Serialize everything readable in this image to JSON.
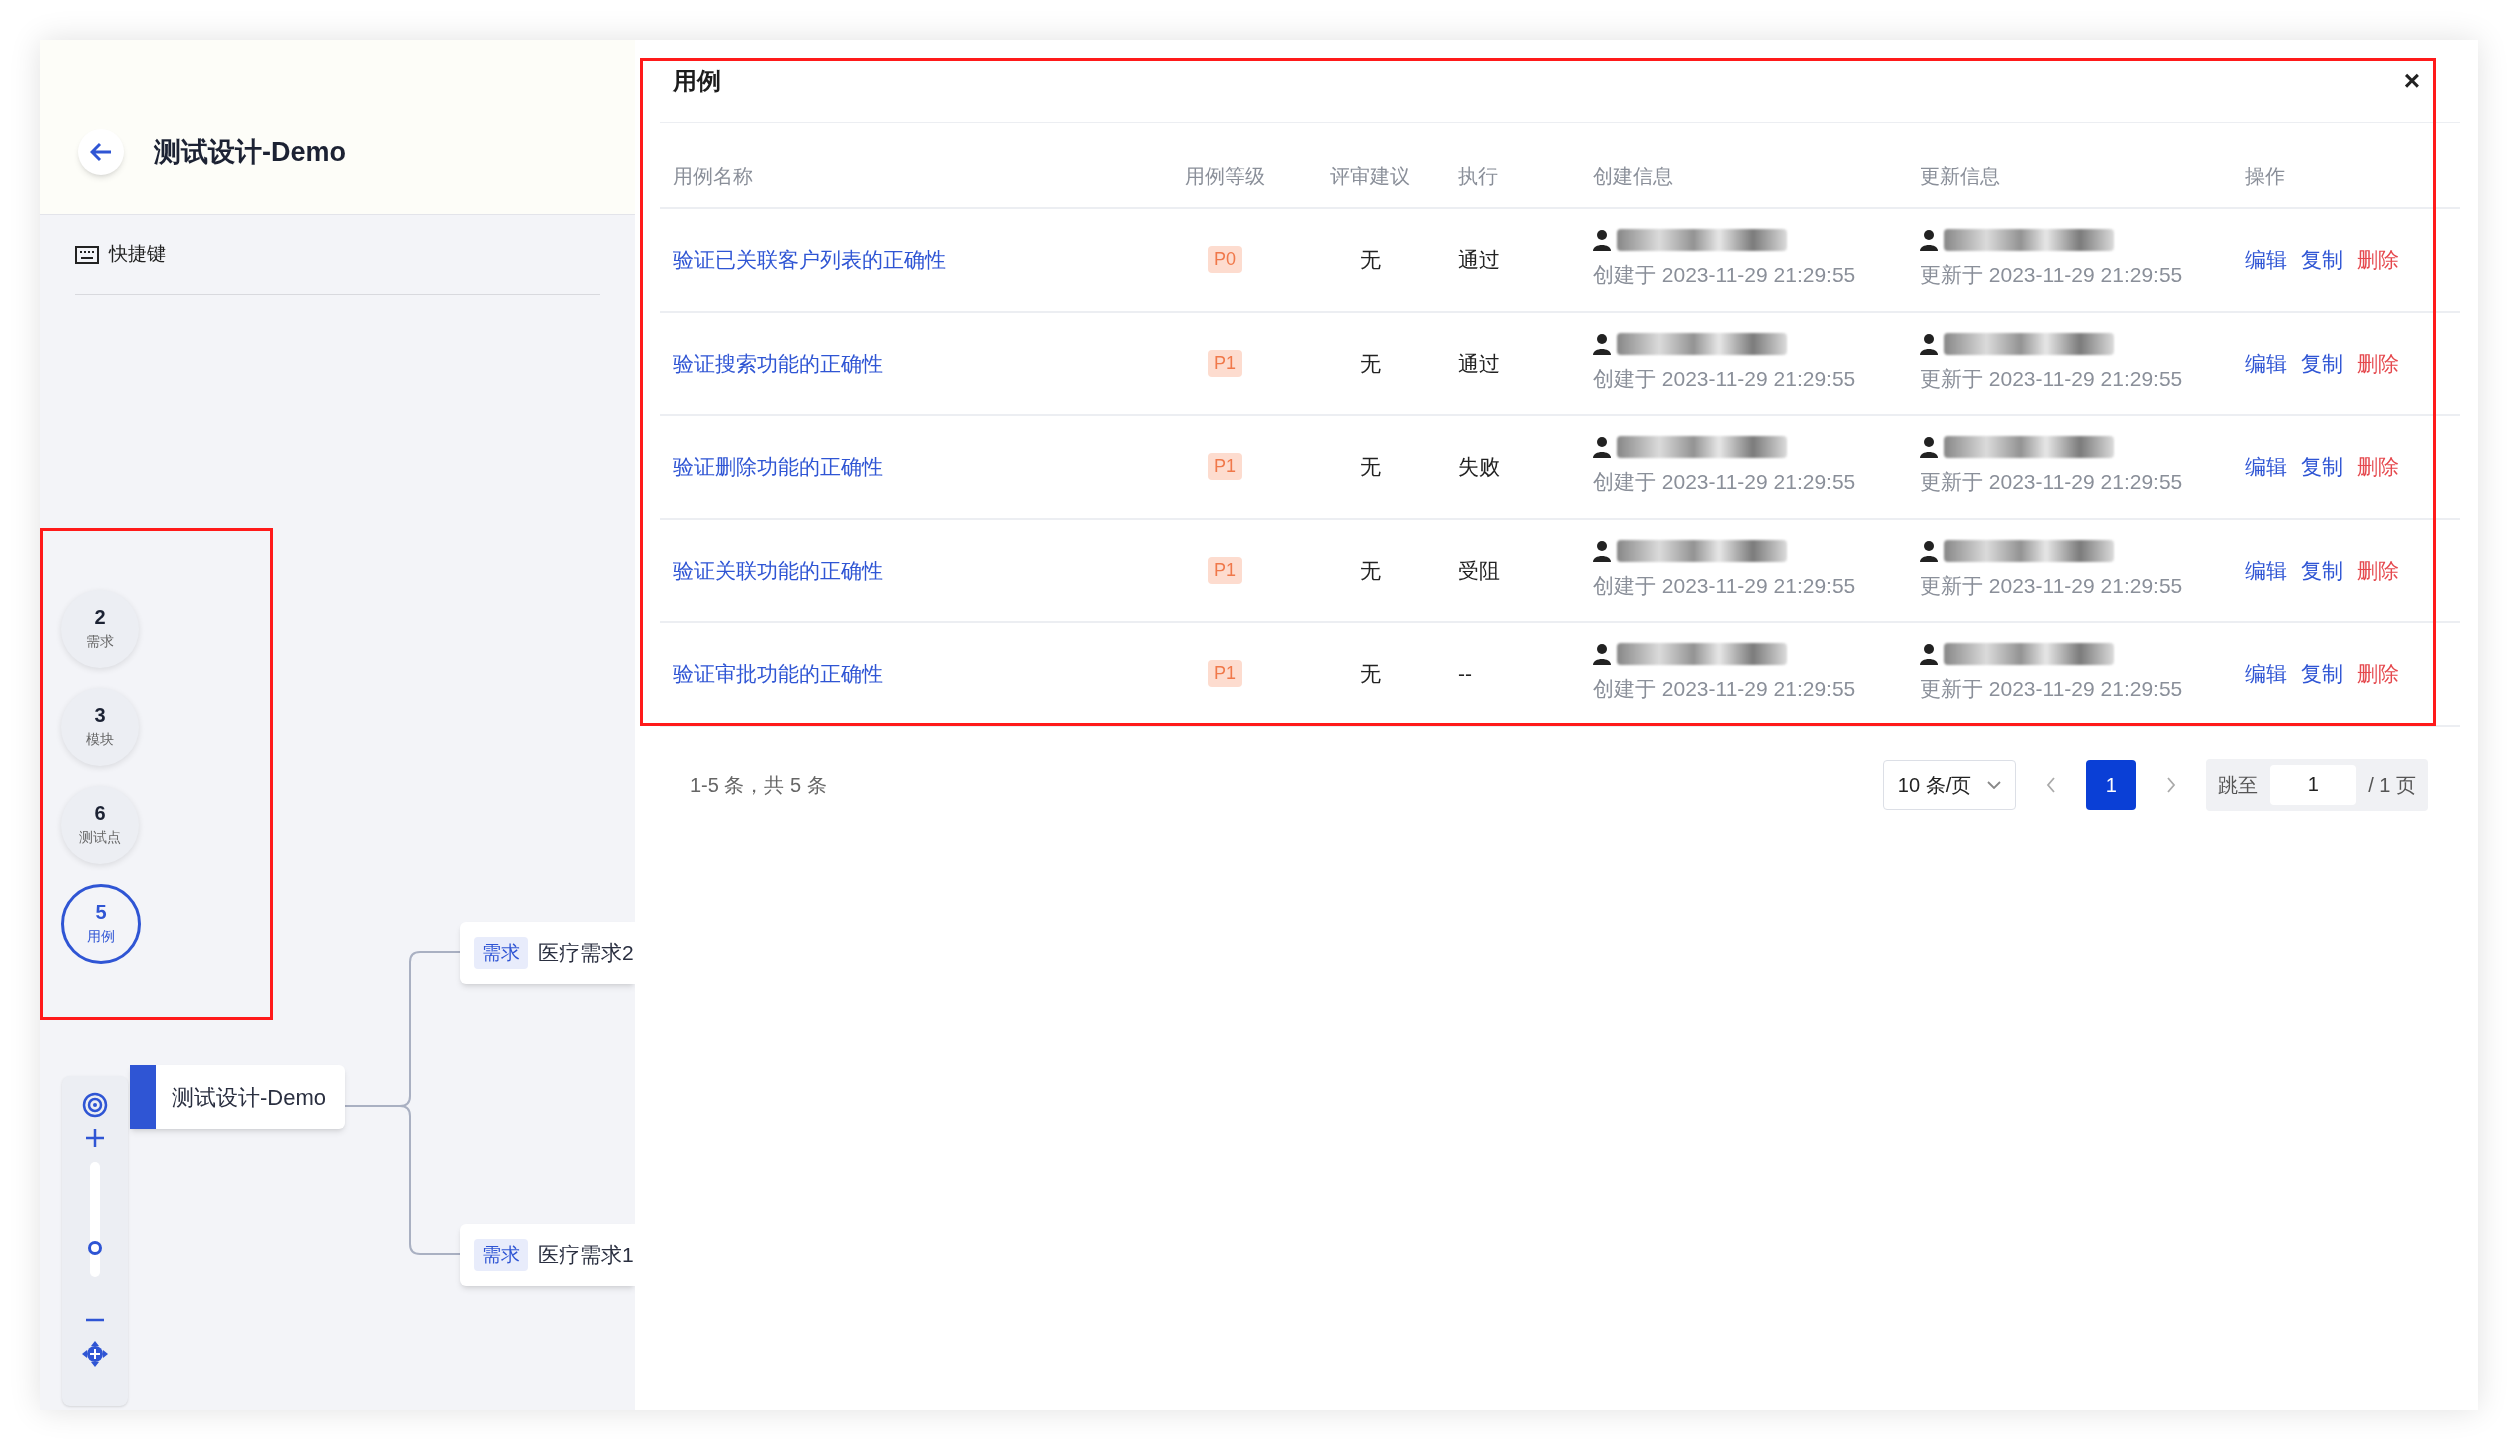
{
  "header": {
    "title": "测试设计-Demo"
  },
  "shortcut": {
    "label": "快捷键"
  },
  "stats": [
    {
      "count": "2",
      "label": "需求",
      "selected": false
    },
    {
      "count": "3",
      "label": "模块",
      "selected": false
    },
    {
      "count": "6",
      "label": "测试点",
      "selected": false
    },
    {
      "count": "5",
      "label": "用例",
      "selected": true
    }
  ],
  "mind_map": {
    "root": "测试设计-Demo",
    "children": [
      {
        "tag": "需求",
        "label": "医疗需求2"
      },
      {
        "tag": "需求",
        "label": "医疗需求1"
      }
    ]
  },
  "zoom_control": {
    "level": 0.25
  },
  "dialog": {
    "title": "用例",
    "close": "×",
    "columns": [
      "用例名称",
      "用例等级",
      "评审建议",
      "执行",
      "创建信息",
      "更新信息",
      "操作"
    ],
    "rows": [
      {
        "name": "验证已关联客户列表的正确性",
        "level_tag": "P0",
        "review": "无",
        "execution": "通过",
        "created": "创建于 2023-11-29 21:29:55",
        "updated": "更新于 2023-11-29 21:29:55",
        "actions": [
          {
            "label": "编辑",
            "kind": "normal"
          },
          {
            "label": "复制",
            "kind": "normal"
          },
          {
            "label": "删除",
            "kind": "danger"
          }
        ]
      },
      {
        "name": "验证搜索功能的正确性",
        "level_tag": "P1",
        "review": "无",
        "execution": "通过",
        "created": "创建于 2023-11-29 21:29:55",
        "updated": "更新于 2023-11-29 21:29:55",
        "actions": [
          {
            "label": "编辑",
            "kind": "normal"
          },
          {
            "label": "复制",
            "kind": "normal"
          },
          {
            "label": "删除",
            "kind": "danger"
          }
        ]
      },
      {
        "name": "验证删除功能的正确性",
        "level_tag": "P1",
        "review": "无",
        "execution": "失败",
        "created": "创建于 2023-11-29 21:29:55",
        "updated": "更新于 2023-11-29 21:29:55",
        "actions": [
          {
            "label": "编辑",
            "kind": "normal"
          },
          {
            "label": "复制",
            "kind": "normal"
          },
          {
            "label": "删除",
            "kind": "danger"
          }
        ]
      },
      {
        "name": "验证关联功能的正确性",
        "level_tag": "P1",
        "review": "无",
        "execution": "受阻",
        "created": "创建于 2023-11-29 21:29:55",
        "updated": "更新于 2023-11-29 21:29:55",
        "actions": [
          {
            "label": "编辑",
            "kind": "normal"
          },
          {
            "label": "复制",
            "kind": "normal"
          },
          {
            "label": "删除",
            "kind": "danger"
          }
        ]
      },
      {
        "name": "验证审批功能的正确性",
        "level_tag": "P1",
        "review": "无",
        "execution": "--",
        "created": "创建于 2023-11-29 21:29:55",
        "updated": "更新于 2023-11-29 21:29:55",
        "actions": [
          {
            "label": "编辑",
            "kind": "normal"
          },
          {
            "label": "复制",
            "kind": "normal"
          },
          {
            "label": "删除",
            "kind": "danger"
          }
        ]
      }
    ],
    "pagination": {
      "summary": "1-5 条，共 5 条",
      "page_size": "10 条/页",
      "pages": [
        {
          "label": "1",
          "selected": true
        }
      ],
      "jump_label": "跳至",
      "jump_value": "1",
      "total": "/ 1 页"
    }
  }
}
